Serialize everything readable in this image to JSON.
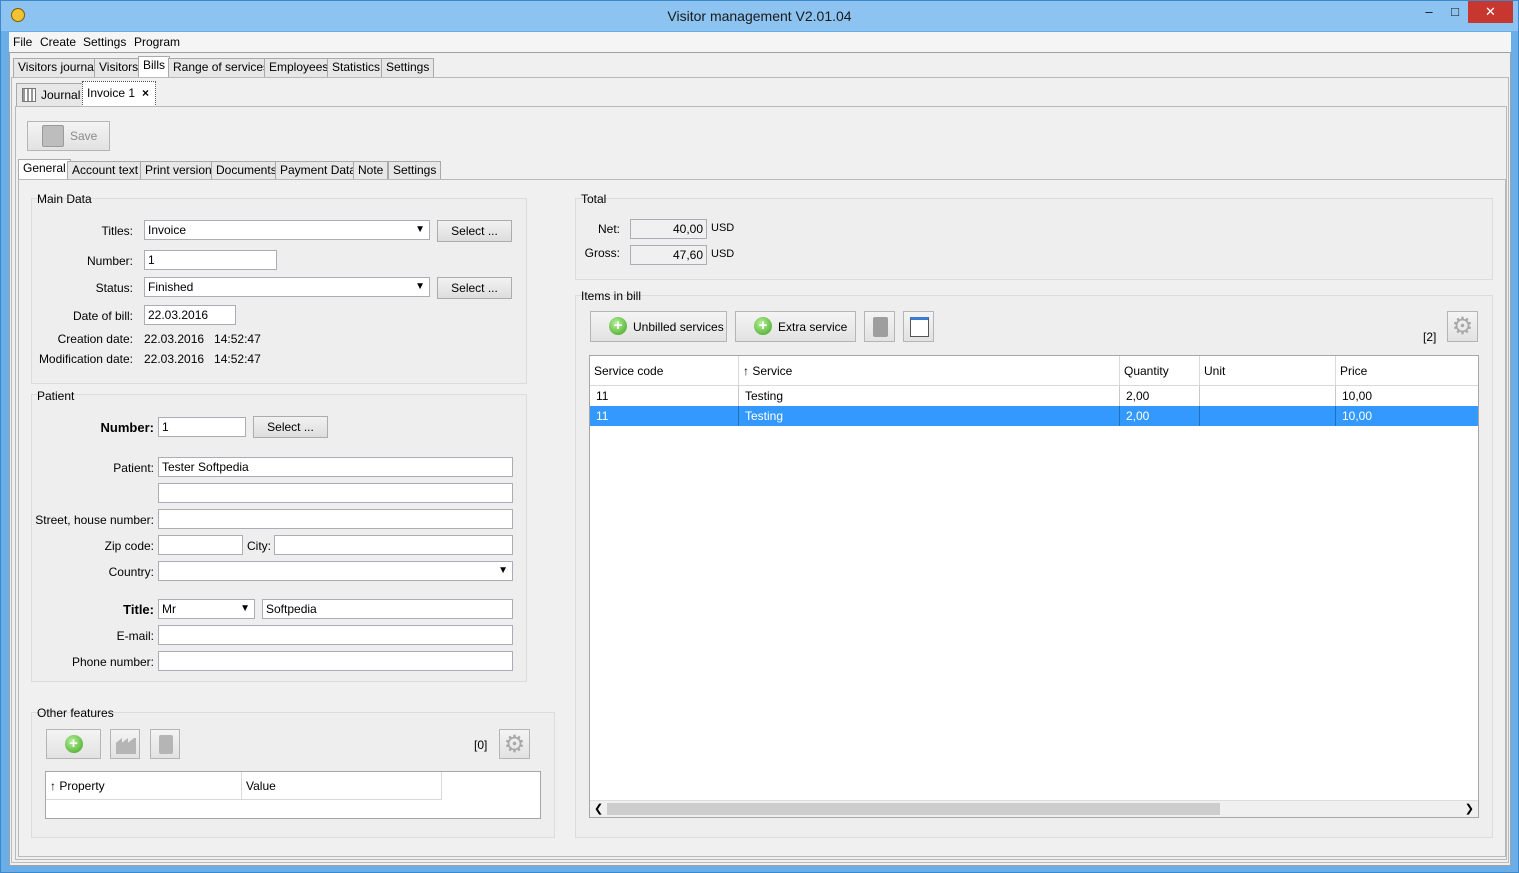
{
  "window": {
    "title": "Visitor management V2.01.04",
    "minimize": "–",
    "maximize": "□",
    "close": "✕"
  },
  "menu": [
    "File",
    "Create",
    "Settings",
    "Program"
  ],
  "main_tabs": [
    "Visitors journal",
    "Visitors",
    "Bills",
    "Range of services",
    "Employees",
    "Statistics",
    "Settings"
  ],
  "doc_tabs": {
    "journal": "Journal",
    "invoice": "Invoice 1",
    "close": "×"
  },
  "toolbar": {
    "save_label": "Save"
  },
  "sub_tabs": [
    "General",
    "Account text",
    "Print version",
    "Documents",
    "Payment Data",
    "Note",
    "Settings"
  ],
  "main_data": {
    "legend": "Main Data",
    "titles_label": "Titles:",
    "titles_value": "Invoice",
    "select_label": "Select ...",
    "number_label": "Number:",
    "number_value": "1",
    "status_label": "Status:",
    "status_value": "Finished",
    "date_label": "Date of bill:",
    "date_value": "22.03.2016",
    "creation_label": "Creation date:",
    "creation_value": "22.03.2016   14:52:47",
    "modification_label": "Modification date:",
    "modification_value": "22.03.2016   14:52:47"
  },
  "patient": {
    "legend": "Patient",
    "number_label": "Number:",
    "number_value": "1",
    "select_label": "Select ...",
    "patient_label": "Patient:",
    "patient_value": "Tester Softpedia",
    "patient_value2": "",
    "street_label": "Street, house number:",
    "street_value": "",
    "zip_label": "Zip code:",
    "zip_value": "",
    "city_label": "City:",
    "city_value": "",
    "country_label": "Country:",
    "country_value": "",
    "title_label": "Title:",
    "title_value": "Mr",
    "title_text": "Softpedia",
    "email_label": "E-mail:",
    "email_value": "",
    "phone_label": "Phone number:",
    "phone_value": ""
  },
  "other_features": {
    "legend": "Other features",
    "count": "[0]",
    "columns": [
      "↑ Property",
      "Value"
    ]
  },
  "total": {
    "legend": "Total",
    "net_label": "Net:",
    "net_value": "40,00",
    "net_currency": "USD",
    "gross_label": "Gross:",
    "gross_value": "47,60",
    "gross_currency": "USD"
  },
  "items": {
    "legend": "Items in bill",
    "unbilled_label": "Unbilled services",
    "extra_label": "Extra service",
    "count": "[2]",
    "columns": [
      "Service code",
      "↑ Service",
      "Quantity",
      "Unit",
      "Price"
    ],
    "rows": [
      {
        "code": "11",
        "service": "Testing",
        "quantity": "2,00",
        "unit": "",
        "price": "10,00"
      },
      {
        "code": "11",
        "service": "Testing",
        "quantity": "2,00",
        "unit": "",
        "price": "10,00"
      }
    ]
  }
}
